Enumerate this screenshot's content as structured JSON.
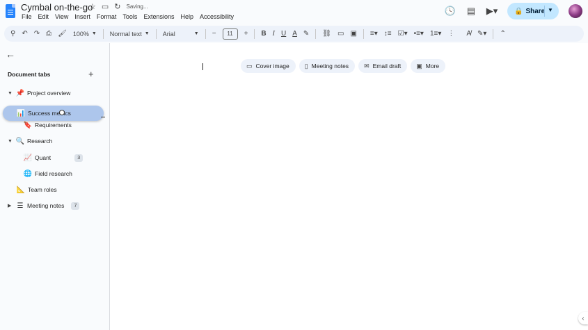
{
  "document": {
    "title": "Cymbal on-the-go",
    "save_status": "Saving..."
  },
  "menu": [
    "File",
    "Edit",
    "View",
    "Insert",
    "Format",
    "Tools",
    "Extensions",
    "Help",
    "Accessibility"
  ],
  "header": {
    "share_label": "Share"
  },
  "toolbar": {
    "zoom": "100%",
    "style": "Normal text",
    "font": "Arial",
    "font_size": "11"
  },
  "sidebar": {
    "header": "Document tabs",
    "tabs": [
      {
        "label": "Project overview",
        "emoji": "📌"
      },
      {
        "label": "Success metrics",
        "emoji": "📊"
      },
      {
        "label": "Requirements",
        "emoji": "🔖"
      },
      {
        "label": "Research",
        "emoji": "🔍"
      },
      {
        "label": "Quant",
        "emoji": "📈",
        "badge": "3"
      },
      {
        "label": "Field research",
        "emoji": "🌐"
      },
      {
        "label": "Team roles",
        "emoji": "📐"
      },
      {
        "label": "Meeting notes",
        "emoji": "☰",
        "badge": "7"
      }
    ]
  },
  "chips": [
    {
      "label": "Cover image",
      "icon": "image-icon"
    },
    {
      "label": "Meeting notes",
      "icon": "notes-icon"
    },
    {
      "label": "Email draft",
      "icon": "email-icon"
    },
    {
      "label": "More",
      "icon": "more-icon"
    }
  ],
  "colors": {
    "accent": "#c2e7ff",
    "toolbar_bg": "#edf2fa",
    "drag_highlight": "#adc6ec"
  }
}
